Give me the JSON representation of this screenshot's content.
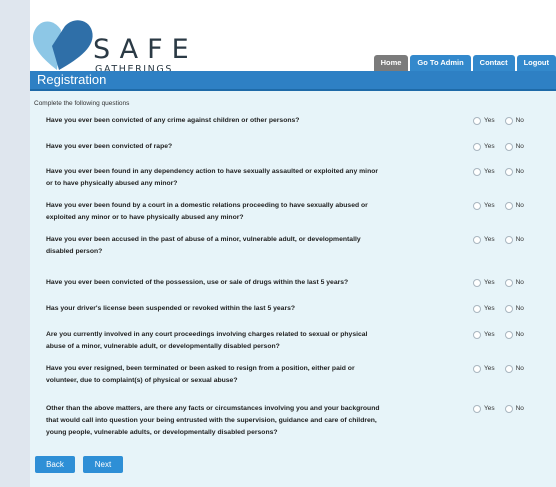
{
  "brand": {
    "name": "SAFE",
    "tagline": "GATHERINGS",
    "colors": {
      "light": "#8dc7e6",
      "dark": "#2f6fa8"
    }
  },
  "nav": {
    "tabs": [
      {
        "label": "Home",
        "active": true
      },
      {
        "label": "Go To Admin",
        "active": false
      },
      {
        "label": "Contact",
        "active": false
      },
      {
        "label": "Logout",
        "active": false
      }
    ]
  },
  "page": {
    "title": "Registration",
    "instructions": "Complete the following questions"
  },
  "answers": {
    "yes_label": "Yes",
    "no_label": "No"
  },
  "questions": [
    {
      "lines": [
        "Have you ever been convicted of any crime against children or other persons?"
      ]
    },
    {
      "lines": [
        "Have you ever been convicted of rape?"
      ]
    },
    {
      "lines": [
        "Have you ever been found in any dependency action to have sexually assaulted or exploited any minor",
        "or to have physically abused any minor?"
      ]
    },
    {
      "lines": [
        "Have you ever been found by a court in a domestic relations proceeding to have sexually abused or",
        "exploited any minor or to have physically abused any minor?"
      ]
    },
    {
      "lines": [
        "Have you ever been accused in the past of abuse of a minor, vulnerable adult, or developmentally",
        "disabled person?"
      ]
    },
    {
      "lines": [
        "Have you ever been convicted of the possession, use or sale of drugs within the last 5 years?"
      ]
    },
    {
      "lines": [
        "Has your driver's license been suspended or revoked within the last 5 years?"
      ]
    },
    {
      "lines": [
        "Are you currently involved in any court proceedings involving charges related to sexual or physical",
        "abuse of a minor, vulnerable adult, or developmentally disabled person?"
      ]
    },
    {
      "lines": [
        "Have you ever resigned, been terminated or been asked to resign from a position, either paid or",
        "volunteer, due to complaint(s) of physical or sexual abuse?"
      ]
    },
    {
      "lines": [
        "Other than the above matters, are there any facts or circumstances involving you and your background",
        "that would call into question your being entrusted with the supervision, guidance and care of children,",
        "young people, vulnerable adults, or developmentally disabled persons?"
      ]
    }
  ],
  "buttons": {
    "back_label": "Back",
    "next_label": "Next"
  }
}
